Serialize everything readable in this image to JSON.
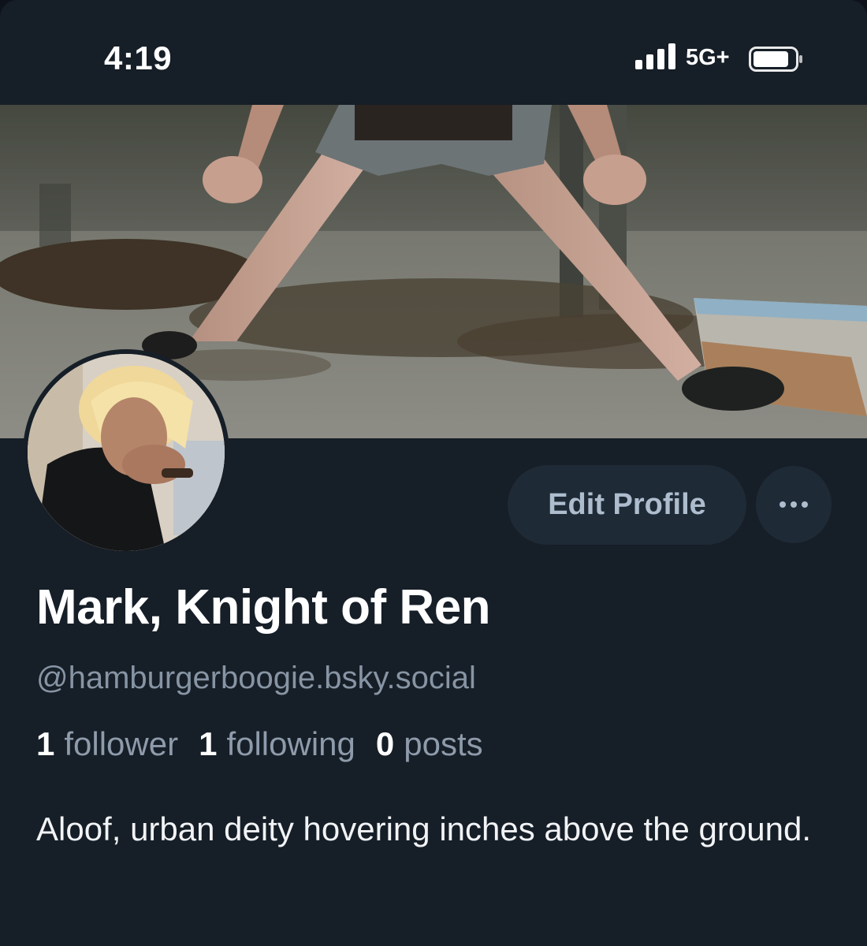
{
  "status_bar": {
    "time": "4:19",
    "network": "5G+",
    "icons": [
      "signal-bars-icon",
      "battery-icon"
    ]
  },
  "profile": {
    "display_name": "Mark, Knight of Ren",
    "handle": "@hamburgerboogie.bsky.social",
    "stats": {
      "followers_count": "1",
      "followers_label": "follower",
      "following_count": "1",
      "following_label": "following",
      "posts_count": "0",
      "posts_label": "posts"
    },
    "bio": "Aloof, urban deity hovering inches above the ground."
  },
  "actions": {
    "edit_profile_label": "Edit Profile",
    "more_icon": "ellipsis-icon"
  },
  "colors": {
    "background": "#161e27",
    "button_bg": "#1f2a37",
    "button_text": "#aebdcd",
    "handle_text": "#8794a4"
  }
}
